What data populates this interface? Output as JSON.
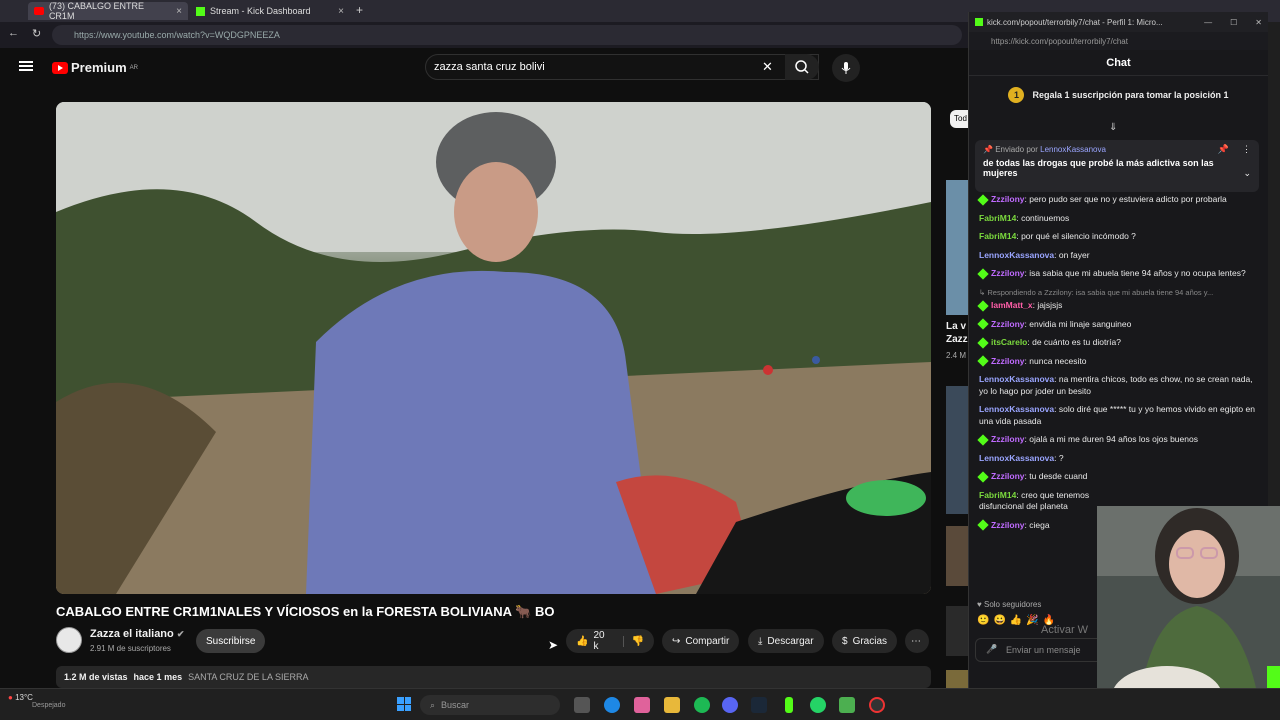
{
  "browser": {
    "tabs": [
      {
        "label": "(73) CABALGO ENTRE CR1M",
        "active": true
      },
      {
        "label": "Stream - Kick Dashboard",
        "active": false
      }
    ],
    "url": "https://www.youtube.com/watch?v=WQDGPNEEZA"
  },
  "youtube": {
    "logo": "Premium",
    "logo_region": "AR",
    "search_value": "zazza santa cruz bolivi",
    "video_title": "CABALGO ENTRE CR1M1NALES Y VÍCIOSOS en la FORESTA BOLIVIANA 🐂 BO",
    "channel_name": "Zazza el italiano",
    "subscribers": "2.91 M de suscriptores",
    "subscribe_label": "Suscribirse",
    "likes": "20 k",
    "share_label": "Compartir",
    "download_label": "Descargar",
    "thanks_label": "Gracias",
    "views": "1.2 M de vistas",
    "posted": "hace 1 mes",
    "location": "SANTA CRUZ DE LA SIERRA",
    "side_chip": "Tod",
    "side_title": "La v",
    "side_title2": "Zazz",
    "side_views": "2.4 M"
  },
  "chat": {
    "window_title": "kick.com/popout/terrorbily7/chat - Perfil 1: Micro...",
    "url": "https://kick.com/popout/terrorbily7/chat",
    "header": "Chat",
    "gift_text": "Regala 1 suscripción para tomar la posición 1",
    "gift_rank": "1",
    "pinned_by_prefix": "Enviado por",
    "pinned_by": "LennoxKassanova",
    "pinned_text": "de todas las drogas que probé la más adictiva son las mujeres",
    "reply_preview": "Respondiendo a Zzzilony: isa sabia que mi abuela tiene 94 años y...",
    "messages": [
      {
        "user": "Zzzilony",
        "text": "pero pudo ser que no y estuviera adicto por probarla",
        "color": "purple"
      },
      {
        "user": "FabriM14",
        "text": "continuemos",
        "color": "green"
      },
      {
        "user": "FabriM14",
        "text": "por qué el silencio incómodo ?",
        "color": "green"
      },
      {
        "user": "LennoxKassanova",
        "text": "on fayer",
        "color": "blue"
      },
      {
        "user": "Zzzilony",
        "text": "isa sabia que mi abuela tiene 94 años y no ocupa lentes?",
        "color": "purple"
      },
      {
        "user": "IamMatt_x",
        "text": "jajsjsjs",
        "color": "pink"
      },
      {
        "user": "Zzzilony",
        "text": "envidia mi linaje sanguineo",
        "color": "purple"
      },
      {
        "user": "itsCarelo",
        "text": "de cuánto es tu diotría?",
        "color": "green"
      },
      {
        "user": "Zzzilony",
        "text": "nunca necesito",
        "color": "purple"
      },
      {
        "user": "LennoxKassanova",
        "text": "na mentira chicos, todo es chow, no se crean nada, yo lo hago por joder un besito",
        "color": "blue"
      },
      {
        "user": "LennoxKassanova",
        "text": "solo diré que ***** tu y yo hemos vivido en egipto en una vida pasada",
        "color": "blue"
      },
      {
        "user": "Zzzilony",
        "text": "ojalá a mi me duren 94 años los ojos buenos",
        "color": "purple"
      },
      {
        "user": "LennoxKassanova",
        "text": "?",
        "color": "blue"
      },
      {
        "user": "Zzzilony",
        "text": "tu desde cuand",
        "color": "purple"
      },
      {
        "user": "FabriM14",
        "text": "creo que tenemos disfuncional del planeta",
        "color": "green"
      },
      {
        "user": "Zzzilony",
        "text": "ciega",
        "color": "purple"
      }
    ],
    "followers_only": "Solo seguidores",
    "input_placeholder": "Enviar un mensaje",
    "watermark": "Activar W"
  },
  "taskbar": {
    "weather_temp": "13°C",
    "weather_desc": "Despejado",
    "search_placeholder": "Buscar"
  },
  "colors": {
    "youtube_red": "#ff0000",
    "kick_green": "#53fc18"
  }
}
